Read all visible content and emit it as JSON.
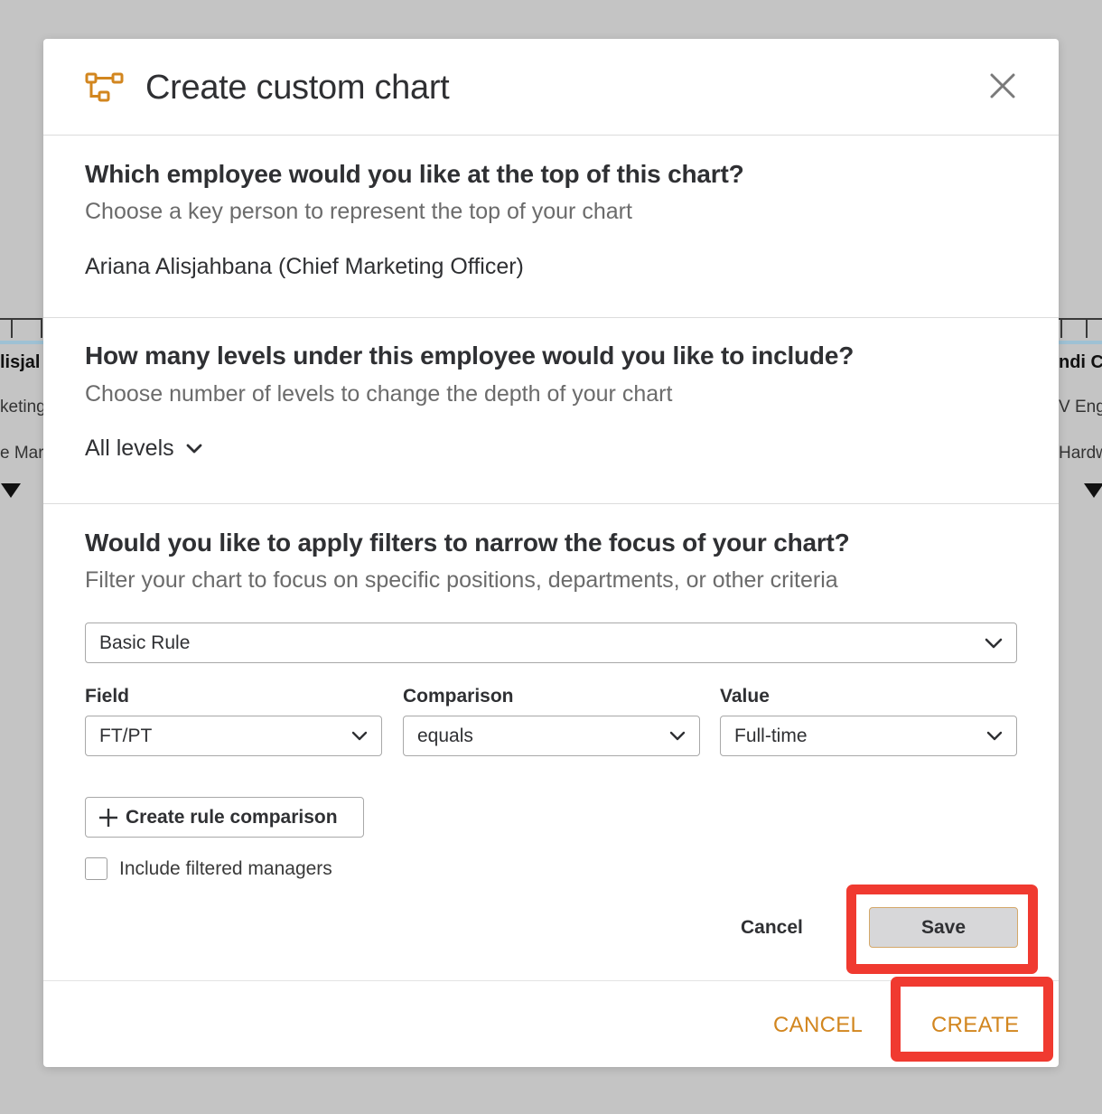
{
  "background": {
    "left_card": {
      "name": "lisjal",
      "line1": "keting",
      "line2": "e Mar"
    },
    "right_card": {
      "name": "ndi Cl",
      "line1": "V Eng",
      "line2": "Hardw"
    }
  },
  "modal": {
    "title": "Create custom chart",
    "header_icon": "org-chart-icon",
    "close_icon": "close-icon"
  },
  "top_employee": {
    "question": "Which employee would you like at the top of this chart?",
    "subtitle": "Choose a key person to represent the top of your chart",
    "selected": "Ariana Alisjahbana (Chief Marketing Officer)"
  },
  "levels": {
    "question": "How many levels under this employee would you like to include?",
    "subtitle": "Choose number of levels to change the depth of your chart",
    "selected": "All levels"
  },
  "filters": {
    "question": "Would you like to apply filters to narrow the focus of your chart?",
    "subtitle": "Filter your chart to focus on specific positions, departments, or other criteria",
    "rule_type": "Basic Rule",
    "field_label": "Field",
    "field_value": "FT/PT",
    "comparison_label": "Comparison",
    "comparison_value": "equals",
    "value_label": "Value",
    "value_value": "Full-time",
    "create_rule_label": "Create rule comparison",
    "include_managers_label": "Include filtered managers",
    "include_managers_checked": false,
    "cancel_label": "Cancel",
    "save_label": "Save"
  },
  "footer": {
    "cancel_label": "CANCEL",
    "create_label": "CREATE"
  },
  "colors": {
    "accent": "#d2861f",
    "highlight": "#f03a30",
    "overlay": "#c4c4c4"
  }
}
